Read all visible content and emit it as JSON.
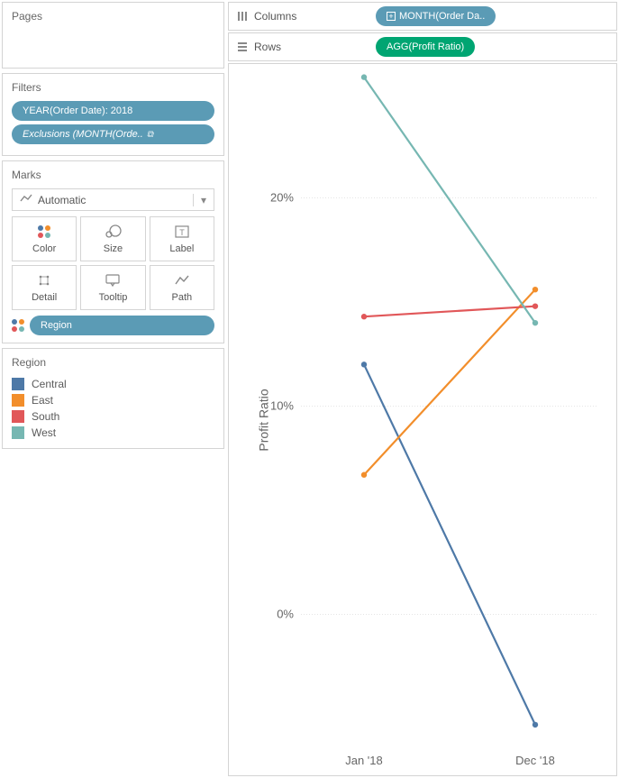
{
  "pages": {
    "title": "Pages"
  },
  "filters": {
    "title": "Filters",
    "items": [
      {
        "label": "YEAR(Order Date): 2018",
        "italic": false
      },
      {
        "label": "Exclusions (MONTH(Orde..",
        "italic": true,
        "linked": true
      }
    ]
  },
  "marks": {
    "title": "Marks",
    "type_label": "Automatic",
    "buttons": [
      {
        "name": "color",
        "label": "Color"
      },
      {
        "name": "size",
        "label": "Size"
      },
      {
        "name": "label",
        "label": "Label"
      },
      {
        "name": "detail",
        "label": "Detail"
      },
      {
        "name": "tooltip",
        "label": "Tooltip"
      },
      {
        "name": "path",
        "label": "Path"
      }
    ],
    "color_pill": "Region"
  },
  "legend": {
    "title": "Region",
    "items": [
      {
        "label": "Central",
        "color": "#4e79a7"
      },
      {
        "label": "East",
        "color": "#f28e2b"
      },
      {
        "label": "South",
        "color": "#e15759"
      },
      {
        "label": "West",
        "color": "#76b7b2"
      }
    ]
  },
  "shelves": {
    "columns": {
      "title": "Columns",
      "pill": "MONTH(Order Da.."
    },
    "rows": {
      "title": "Rows",
      "pill": "AGG(Profit Ratio)"
    }
  },
  "chart_data": {
    "type": "line",
    "title": "",
    "xlabel": "",
    "ylabel": "Profit Ratio",
    "categories": [
      "Jan '18",
      "Dec '18"
    ],
    "ylim": [
      -6,
      26
    ],
    "yticks": [
      0,
      10,
      20
    ],
    "ytick_labels": [
      "0%",
      "10%",
      "20%"
    ],
    "series": [
      {
        "name": "Central",
        "color": "#4e79a7",
        "values": [
          12.0,
          -5.3
        ]
      },
      {
        "name": "East",
        "color": "#f28e2b",
        "values": [
          6.7,
          15.6
        ]
      },
      {
        "name": "South",
        "color": "#e15759",
        "values": [
          14.3,
          14.8
        ]
      },
      {
        "name": "West",
        "color": "#76b7b2",
        "values": [
          25.8,
          14.0
        ]
      }
    ]
  }
}
